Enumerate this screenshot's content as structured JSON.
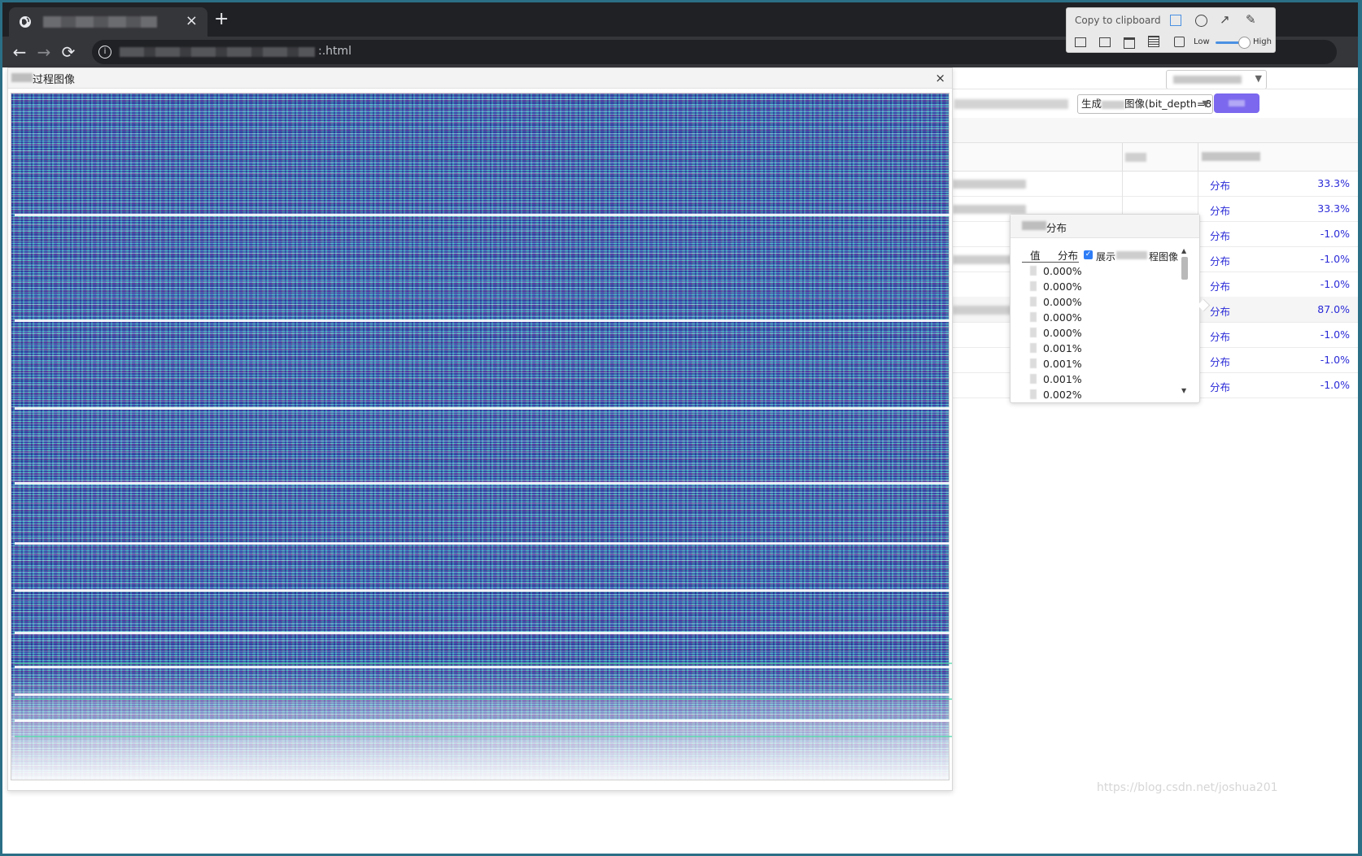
{
  "browser": {
    "tab_close": "×",
    "new_tab": "+",
    "address_tail": ":.html",
    "nav": {
      "back": "←",
      "forward": "→",
      "reload": "⟳"
    }
  },
  "screenshot_tool": {
    "copy_label": "Copy to clipboard",
    "quality_low": "Low",
    "quality_high": "High",
    "quality_level": 0.85,
    "icons": [
      "rectangle-icon",
      "circle-icon",
      "arrow-icon",
      "pencil-icon",
      "window-capture-icon",
      "image-icon",
      "calendar-icon",
      "document-icon",
      "save-icon"
    ]
  },
  "dialog": {
    "title": "过程图像",
    "close": "×"
  },
  "toolbar": {
    "mode_select_prefix": "生成",
    "mode_select_suffix": "图像(bit_depth=8)"
  },
  "table": {
    "rows": [
      {
        "dist": "分布",
        "pct": "33.3%"
      },
      {
        "dist": "分布",
        "pct": "33.3%"
      },
      {
        "dist": "分布",
        "pct": "-1.0%"
      },
      {
        "dist": "分布",
        "pct": "-1.0%"
      },
      {
        "dist": "分布",
        "pct": "-1.0%"
      },
      {
        "dist": "分布",
        "pct": "87.0%"
      },
      {
        "dist": "分布",
        "pct": "-1.0%"
      },
      {
        "dist": "分布",
        "pct": "-1.0%"
      },
      {
        "dist": "分布",
        "pct": "-1.0%"
      }
    ]
  },
  "popover": {
    "title": "分布",
    "col_value": "值",
    "col_dist": "分布",
    "show_prefix": "展示",
    "show_suffix": "程图像",
    "show_checked": true,
    "values": [
      "0.000%",
      "0.000%",
      "0.000%",
      "0.000%",
      "0.000%",
      "0.001%",
      "0.001%",
      "0.001%",
      "0.002%"
    ]
  },
  "watermark": "https://blog.csdn.net/joshua201"
}
